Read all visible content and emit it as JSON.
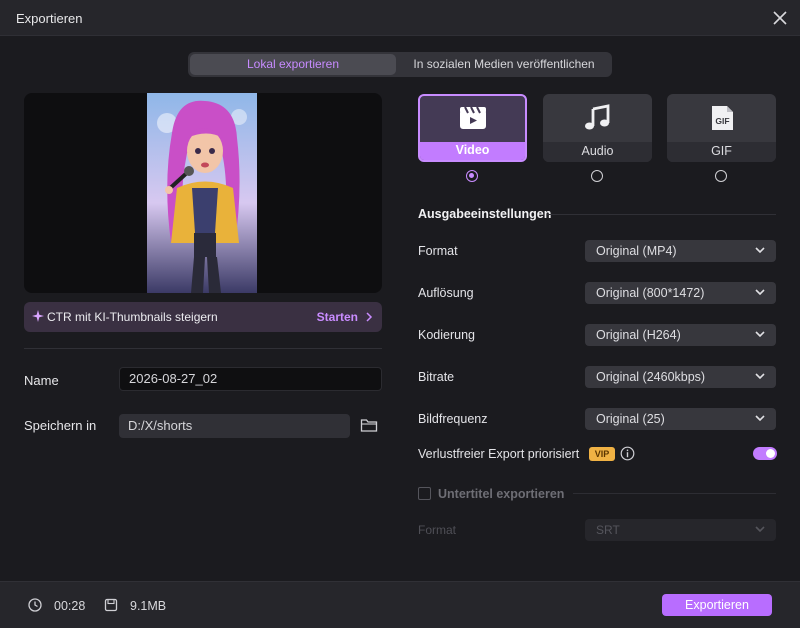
{
  "window": {
    "title": "Exportieren"
  },
  "tabs": [
    {
      "label": "Lokal exportieren",
      "active": true
    },
    {
      "label": "In sozialen Medien veröffentlichen",
      "active": false
    }
  ],
  "ctr_banner": {
    "text": "CTR mit KI-Thumbnails steigern",
    "action": "Starten"
  },
  "name_field": {
    "label": "Name",
    "value": "2026-08-27_02"
  },
  "save_field": {
    "label": "Speichern in",
    "value": "D:/X/shorts"
  },
  "formats": [
    {
      "label": "Video",
      "icon": "video-clapper-icon",
      "selected": true
    },
    {
      "label": "Audio",
      "icon": "music-note-icon",
      "selected": false
    },
    {
      "label": "GIF",
      "icon": "gif-icon",
      "selected": false
    }
  ],
  "output_settings": {
    "title": "Ausgabeeinstellungen",
    "rows": [
      {
        "label": "Format",
        "value": "Original (MP4)"
      },
      {
        "label": "Auflösung",
        "value": "Original (800*1472)"
      },
      {
        "label": "Kodierung",
        "value": "Original (H264)"
      },
      {
        "label": "Bitrate",
        "value": "Original (2460kbps)"
      },
      {
        "label": "Bildfrequenz",
        "value": "Original (25)"
      }
    ],
    "lossless": {
      "label": "Verlustfreier Export priorisiert",
      "badge": "VIP",
      "enabled": true
    }
  },
  "subtitles": {
    "label": "Untertitel exportieren",
    "checked": false,
    "format_label": "Format",
    "format_value": "SRT"
  },
  "footer": {
    "duration": "00:28",
    "size": "9.1MB",
    "export_label": "Exportieren"
  },
  "colors": {
    "accent": "#c27cff",
    "vip": "#f0b244",
    "background": "#1b1b1f"
  }
}
